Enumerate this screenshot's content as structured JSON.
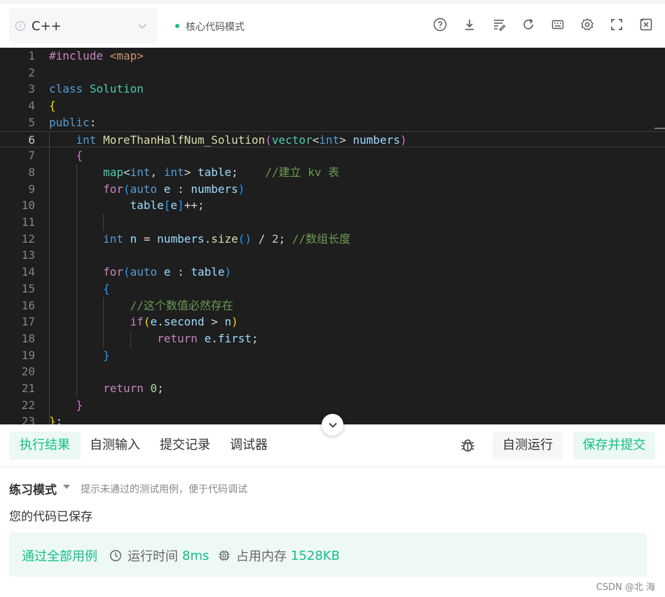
{
  "toolbar": {
    "language": "C++",
    "info_glyph": "i",
    "mode_label": "核心代码模式",
    "icons": [
      "help-icon",
      "download-icon",
      "format-icon",
      "reset-icon",
      "keyboard-icon",
      "settings-icon",
      "fullscreen-icon",
      "close-panel-icon"
    ]
  },
  "editor": {
    "line_numbers": [
      "1",
      "2",
      "3",
      "4",
      "5",
      "6",
      "7",
      "8",
      "9",
      "10",
      "11",
      "12",
      "13",
      "14",
      "15",
      "16",
      "17",
      "18",
      "19",
      "20",
      "21",
      "22",
      "23"
    ],
    "active_line": 6
  },
  "tabs": {
    "result": "执行结果",
    "custom_input": "自测输入",
    "submission_history": "提交记录",
    "debugger": "调试器"
  },
  "actions": {
    "run": "自测运行",
    "submit": "保存并提交"
  },
  "result": {
    "mode_title": "练习模式",
    "mode_hint": "提示未通过的测试用例，便于代码调试",
    "saved": "您的代码已保存",
    "pass": "通过全部用例",
    "runtime_label": "运行时间",
    "runtime_value": "8ms",
    "memory_label": "占用内存",
    "memory_value": "1528KB"
  },
  "watermark": "CSDN @北   海",
  "colors": {
    "accent": "#12c088",
    "editor_bg": "#1e1e1e",
    "keyword": "#569cd6",
    "type": "#4ec9b0",
    "comment": "#6a9955"
  }
}
